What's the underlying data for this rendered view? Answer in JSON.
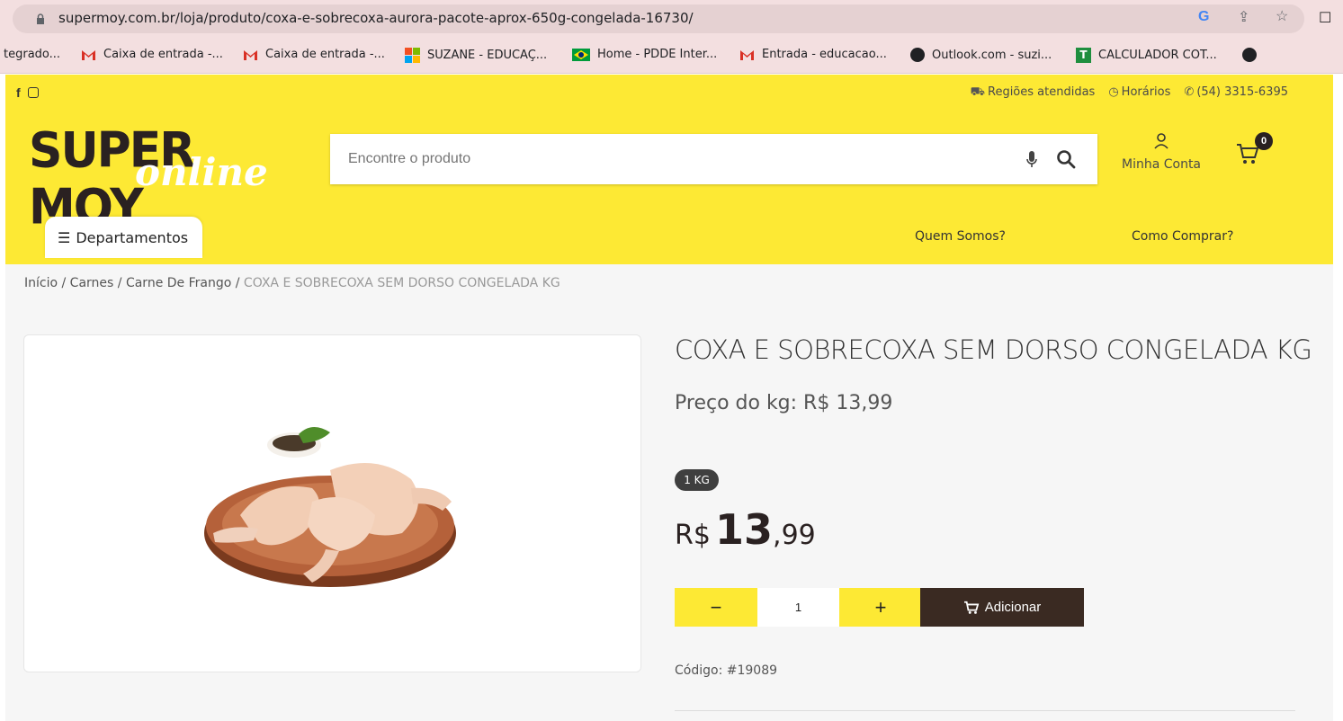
{
  "browser": {
    "url": "supermoy.com.br/loja/produto/coxa-e-sobrecoxa-aurora-pacote-aprox-650g-congelada-16730/",
    "bookmarks": [
      "tegrado...",
      "Caixa de entrada -...",
      "Caixa de entrada -...",
      "SUZANE - EDUCAÇ...",
      "Home - PDDE Inter...",
      "Entrada - educacao...",
      "Outlook.com - suzi...",
      "CALCULADOR COT..."
    ]
  },
  "topbar": {
    "regions": "Regiões atendidas",
    "hours": "Horários",
    "phone": "(54) 3315-6395"
  },
  "logo": {
    "line1": "SUPER MOY",
    "line2": "online"
  },
  "search": {
    "placeholder": "Encontre o produto"
  },
  "account": {
    "label": "Minha Conta"
  },
  "cart": {
    "count": "0"
  },
  "nav": {
    "departments": "Departamentos",
    "about": "Quem Somos?",
    "how_to_buy": "Como Comprar?"
  },
  "breadcrumb": {
    "home": "Início",
    "sep": " / ",
    "cat1": "Carnes",
    "cat2": "Carne De Frango",
    "current": "COXA E SOBRECOXA SEM DORSO CONGELADA KG"
  },
  "product": {
    "title": "COXA E SOBRECOXA SEM DORSO CONGELADA KG",
    "price_per_kg": "Preço do kg: R$ 13,99",
    "unit": "1 KG",
    "currency": "R$",
    "price_int": "13",
    "price_dec": ",99",
    "quantity": "1",
    "minus": "−",
    "plus": "+",
    "add_label": "Adicionar",
    "code": "Código: #19089"
  },
  "colors": {
    "brand_yellow": "#fde934",
    "brand_dark": "#3a2a22"
  }
}
